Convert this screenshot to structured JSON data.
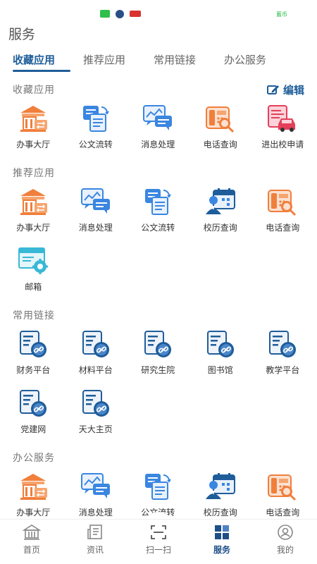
{
  "page_title": "服务",
  "status": {
    "right_text": "蓄币"
  },
  "tabs": [
    {
      "label": "收藏应用",
      "active": true
    },
    {
      "label": "推荐应用",
      "active": false
    },
    {
      "label": "常用链接",
      "active": false
    },
    {
      "label": "办公服务",
      "active": false
    }
  ],
  "sections": {
    "favorites": {
      "title": "收藏应用",
      "edit_label": "编辑",
      "items": [
        {
          "label": "办事大厅",
          "icon": "hall-icon"
        },
        {
          "label": "公文流转",
          "icon": "document-flow-icon"
        },
        {
          "label": "消息处理",
          "icon": "message-icon"
        },
        {
          "label": "电话查询",
          "icon": "phone-query-icon"
        },
        {
          "label": "进出校申请",
          "icon": "campus-car-icon"
        }
      ]
    },
    "recommended": {
      "title": "推荐应用",
      "items": [
        {
          "label": "办事大厅",
          "icon": "hall-icon"
        },
        {
          "label": "消息处理",
          "icon": "message-icon"
        },
        {
          "label": "公文流转",
          "icon": "document-flow-icon"
        },
        {
          "label": "校历查询",
          "icon": "calendar-user-icon"
        },
        {
          "label": "电话查询",
          "icon": "phone-query-icon"
        },
        {
          "label": "邮箱",
          "icon": "mail-gear-icon"
        }
      ]
    },
    "links": {
      "title": "常用链接",
      "items": [
        {
          "label": "财务平台",
          "icon": "link-doc-icon"
        },
        {
          "label": "材料平台",
          "icon": "link-doc-icon"
        },
        {
          "label": "研究生院",
          "icon": "link-doc-icon"
        },
        {
          "label": "图书馆",
          "icon": "link-doc-icon"
        },
        {
          "label": "教学平台",
          "icon": "link-doc-icon"
        },
        {
          "label": "党建网",
          "icon": "link-doc-icon"
        },
        {
          "label": "天大主页",
          "icon": "link-doc-icon"
        }
      ]
    },
    "office": {
      "title": "办公服务",
      "items": [
        {
          "label": "办事大厅",
          "icon": "hall-icon"
        },
        {
          "label": "消息处理",
          "icon": "message-icon"
        },
        {
          "label": "公文流转",
          "icon": "document-flow-icon"
        },
        {
          "label": "校历查询",
          "icon": "calendar-user-icon"
        },
        {
          "label": "电话查询",
          "icon": "phone-query-icon"
        }
      ]
    }
  },
  "bottom_nav": [
    {
      "label": "首页",
      "icon": "home-building-icon",
      "active": false
    },
    {
      "label": "资讯",
      "icon": "news-icon",
      "active": false
    },
    {
      "label": "扫一扫",
      "icon": "scan-icon",
      "active": false
    },
    {
      "label": "服务",
      "icon": "grid-apps-icon",
      "active": true
    },
    {
      "label": "我的",
      "icon": "user-icon",
      "active": false
    }
  ],
  "colors": {
    "accent": "#1f5d9a",
    "orange": "#f07f3c",
    "blue_icon": "#2e7bd6",
    "pink": "#e5405a"
  }
}
